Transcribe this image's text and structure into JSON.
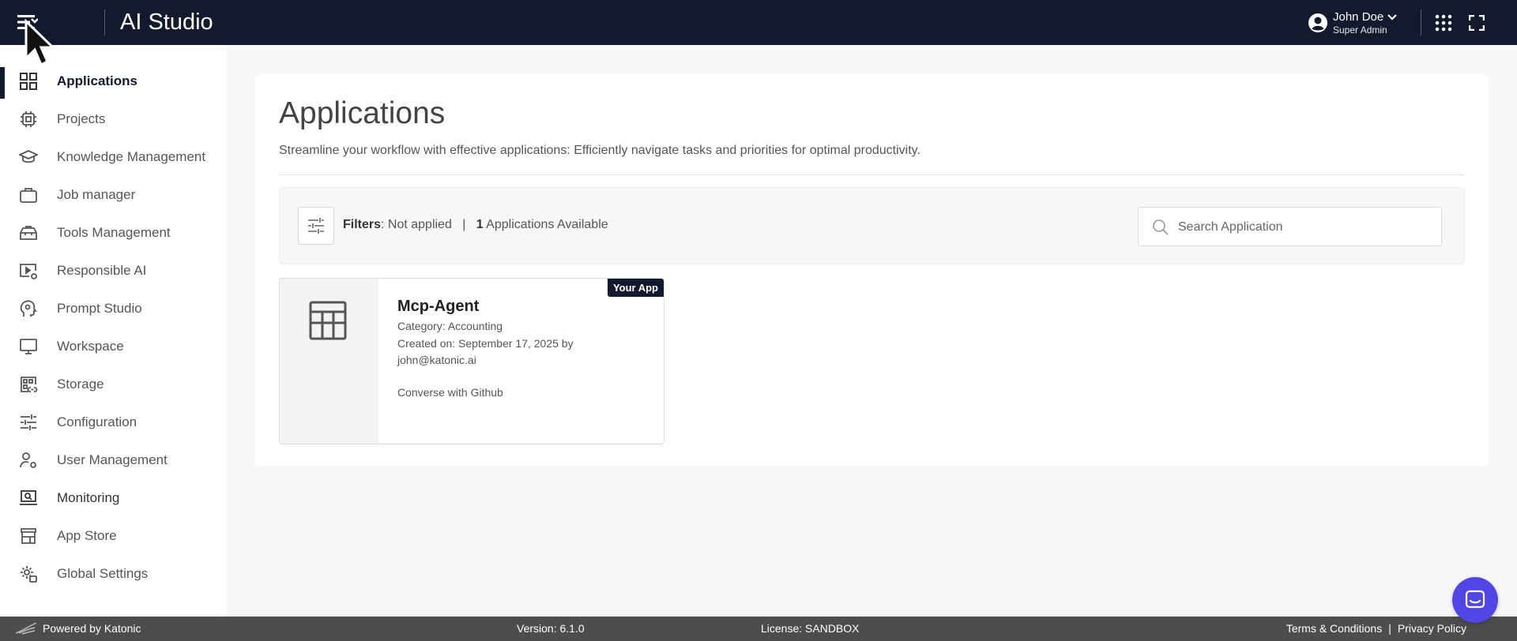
{
  "header": {
    "title": "AI Studio",
    "user_name": "John Doe",
    "user_role": "Super Admin"
  },
  "sidebar": {
    "items": [
      {
        "label": "Applications",
        "icon": "grid-icon",
        "active": true
      },
      {
        "label": "Projects",
        "icon": "chip-icon"
      },
      {
        "label": "Knowledge Management",
        "icon": "graduation-cap-icon"
      },
      {
        "label": "Job manager",
        "icon": "briefcase-icon"
      },
      {
        "label": "Tools Management",
        "icon": "toolbox-icon"
      },
      {
        "label": "Responsible AI",
        "icon": "play-settings-icon"
      },
      {
        "label": "Prompt Studio",
        "icon": "head-gear-icon"
      },
      {
        "label": "Workspace",
        "icon": "monitor-icon"
      },
      {
        "label": "Storage",
        "icon": "storage-link-icon"
      },
      {
        "label": "Configuration",
        "icon": "sliders-icon"
      },
      {
        "label": "User Management",
        "icon": "user-settings-icon"
      },
      {
        "label": "Monitoring",
        "icon": "laptop-search-icon"
      },
      {
        "label": "App Store",
        "icon": "store-icon"
      },
      {
        "label": "Global Settings",
        "icon": "gear-user-icon"
      }
    ]
  },
  "main": {
    "title": "Applications",
    "description": "Streamline your workflow with effective applications: Efficiently navigate tasks and priorities for optimal productivity.",
    "filters_label": "Filters",
    "filters_status": ": Not applied",
    "separator": "|",
    "available_count": "1",
    "available_label": "Applications Available",
    "search_placeholder": "Search Application"
  },
  "apps": [
    {
      "badge": "Your App",
      "name": "Mcp-Agent",
      "category": "Category: Accounting",
      "created": "Created on: September 17, 2025 by john@katonic.ai",
      "description": "Converse with Github"
    }
  ],
  "footer": {
    "powered": "Powered by Katonic",
    "version": "Version: 6.1.0",
    "license": "License: SANDBOX",
    "terms": "Terms & Conditions",
    "separator": "|",
    "privacy": "Privacy Policy"
  },
  "colors": {
    "header_bg": "#131a2e",
    "chat_bubble": "#5046e5",
    "footer_bg": "#4d4d4d"
  }
}
